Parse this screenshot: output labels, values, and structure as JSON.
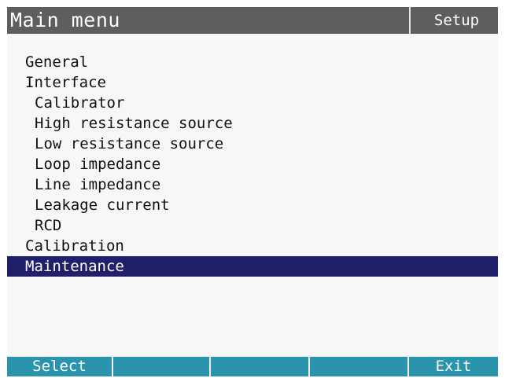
{
  "header": {
    "title": "Main menu",
    "mode": "Setup"
  },
  "menu": {
    "items": [
      {
        "label": "General",
        "level": 0,
        "selected": false
      },
      {
        "label": "Interface",
        "level": 0,
        "selected": false
      },
      {
        "label": "Calibrator",
        "level": 1,
        "selected": false
      },
      {
        "label": "High resistance source",
        "level": 1,
        "selected": false
      },
      {
        "label": "Low resistance source",
        "level": 1,
        "selected": false
      },
      {
        "label": "Loop impedance",
        "level": 1,
        "selected": false
      },
      {
        "label": "Line impedance",
        "level": 1,
        "selected": false
      },
      {
        "label": "Leakage current",
        "level": 1,
        "selected": false
      },
      {
        "label": "RCD",
        "level": 1,
        "selected": false
      },
      {
        "label": "Calibration",
        "level": 0,
        "selected": false
      },
      {
        "label": "Maintenance",
        "level": 0,
        "selected": true
      }
    ]
  },
  "softkeys": [
    {
      "label": "Select"
    },
    {
      "label": ""
    },
    {
      "label": ""
    },
    {
      "label": ""
    },
    {
      "label": "Exit"
    }
  ],
  "colors": {
    "title_bar": "#5e5e5e",
    "selection": "#20206a",
    "softkey_bar": "#2a94ad",
    "screen_background": "#f7f7f7"
  }
}
